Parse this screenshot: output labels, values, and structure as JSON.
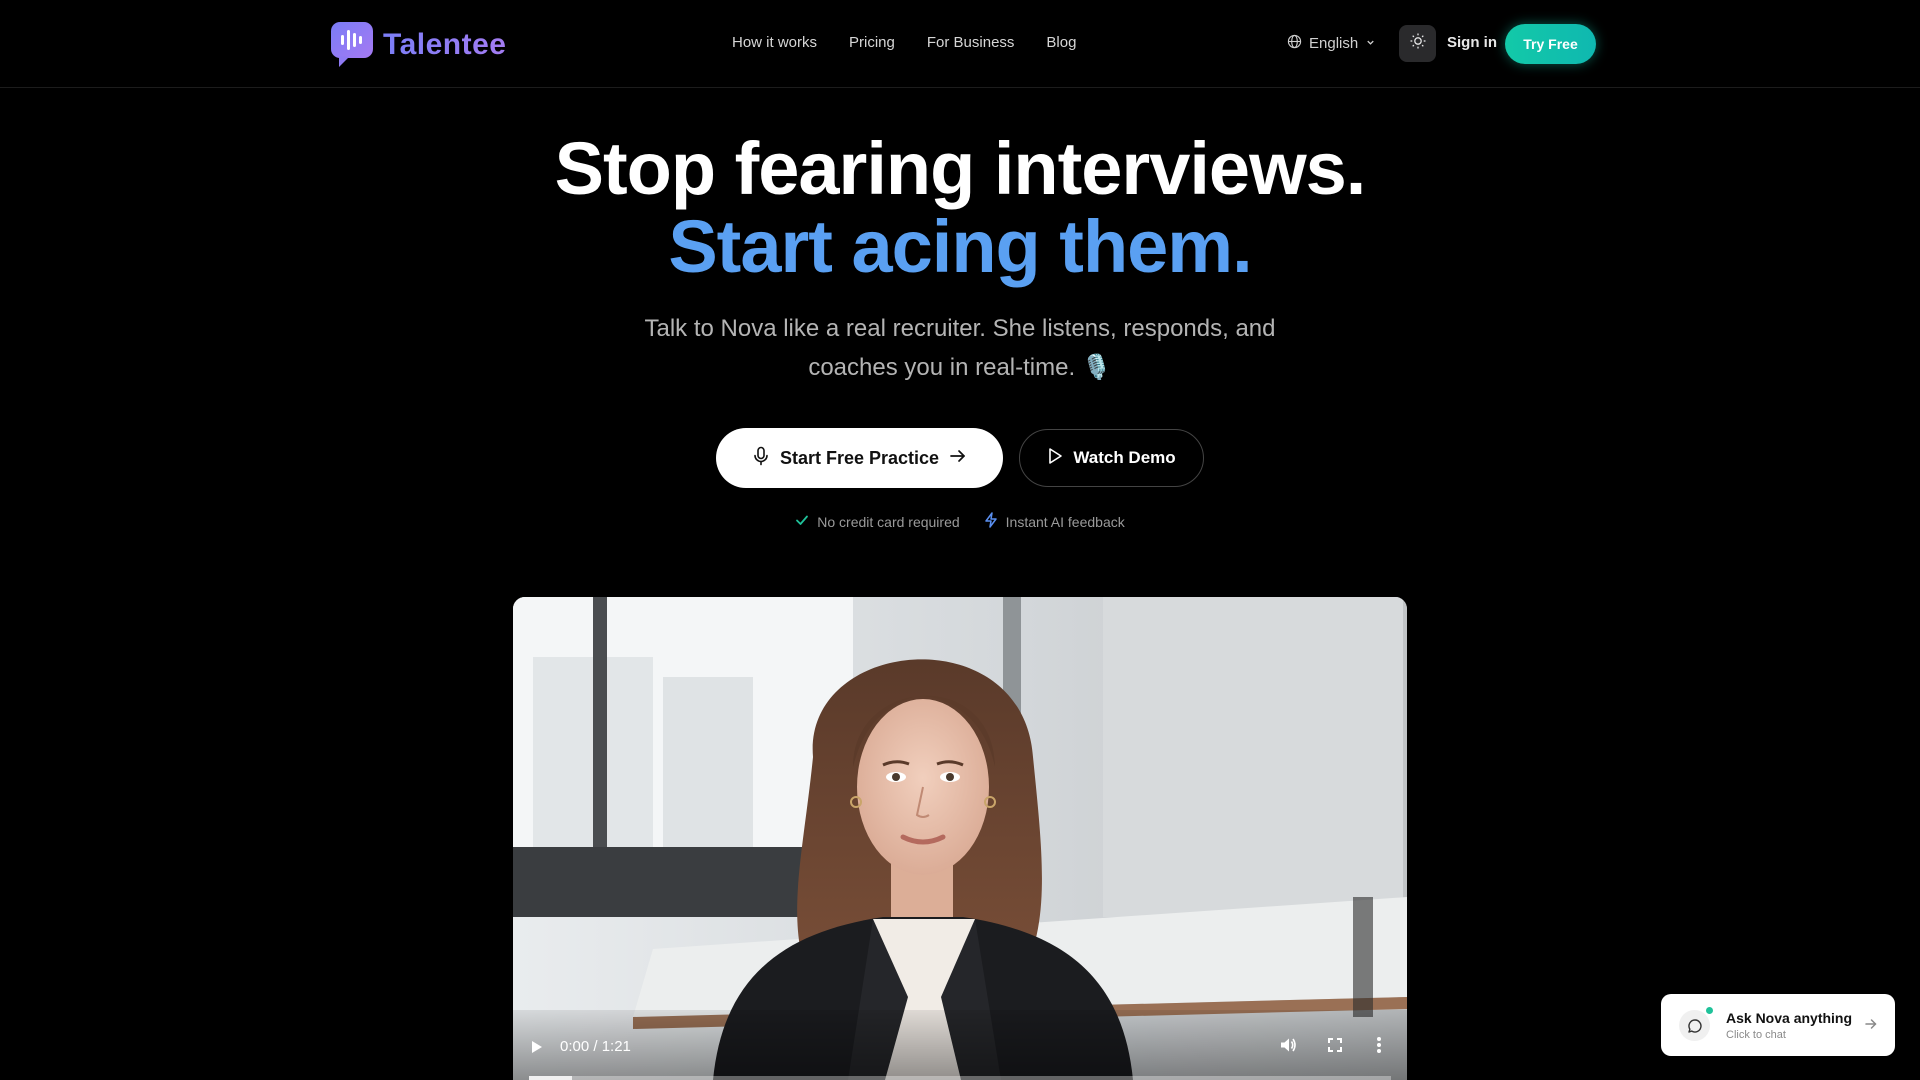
{
  "brand": {
    "name": "Talentee"
  },
  "nav": {
    "items": [
      "How it works",
      "Pricing",
      "For Business",
      "Blog"
    ]
  },
  "header": {
    "language": "English",
    "sign_in": "Sign in",
    "try_free": "Try Free"
  },
  "hero": {
    "headline_1": "Stop fearing interviews.",
    "headline_2": "Start acing them.",
    "subtitle": "Talk to Nova like a real recruiter. She listens, responds, and coaches you in real-time. 🎙️",
    "primary_cta": "Start Free Practice",
    "secondary_cta": "Watch Demo",
    "badge_1": "No credit card required",
    "badge_2": "Instant AI feedback"
  },
  "video": {
    "time": "0:00 / 1:21",
    "progress": 0.05
  },
  "chat_widget": {
    "title": "Ask Nova anything",
    "subtitle": "Click to chat"
  },
  "colors": {
    "accent_blue": "#5aa0f2",
    "accent_teal": "#13c9a8",
    "brand_purple": "#7b7ef7"
  },
  "icons": [
    "logo-icon",
    "globe-icon",
    "chevron-down-icon",
    "sun-icon",
    "mic-icon",
    "arrow-right-icon",
    "play-icon",
    "check-icon",
    "lightning-icon",
    "volume-icon",
    "fullscreen-icon",
    "more-vertical-icon",
    "chat-bubble-icon"
  ]
}
